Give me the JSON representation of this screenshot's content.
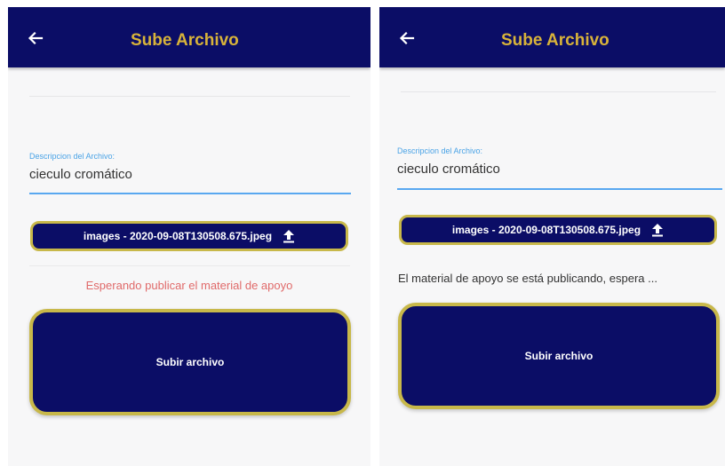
{
  "colors": {
    "appbar": "#0b0d66",
    "title": "#d8b33a",
    "accent_blue": "#59a8f0",
    "gold_border": "#c8b84a",
    "status_waiting": "#e06a6a"
  },
  "screens": [
    {
      "title": "Sube Archivo",
      "back_icon": "arrow-left-icon",
      "field_label": "Descripcion del Archivo:",
      "field_value": "cieculo cromático",
      "file_button_label": "images - 2020-09-08T130508.675.jpeg",
      "upload_icon": "upload-icon",
      "status_text": "Esperando publicar el material de apoyo",
      "submit_label": "Subir archivo"
    },
    {
      "title": "Sube Archivo",
      "back_icon": "arrow-left-icon",
      "field_label": "Descripcion del Archivo:",
      "field_value": "cieculo cromático",
      "file_button_label": "images - 2020-09-08T130508.675.jpeg",
      "upload_icon": "upload-icon",
      "status_text": "El material de apoyo se está publicando, espera ...",
      "submit_label": "Subir archivo"
    }
  ]
}
